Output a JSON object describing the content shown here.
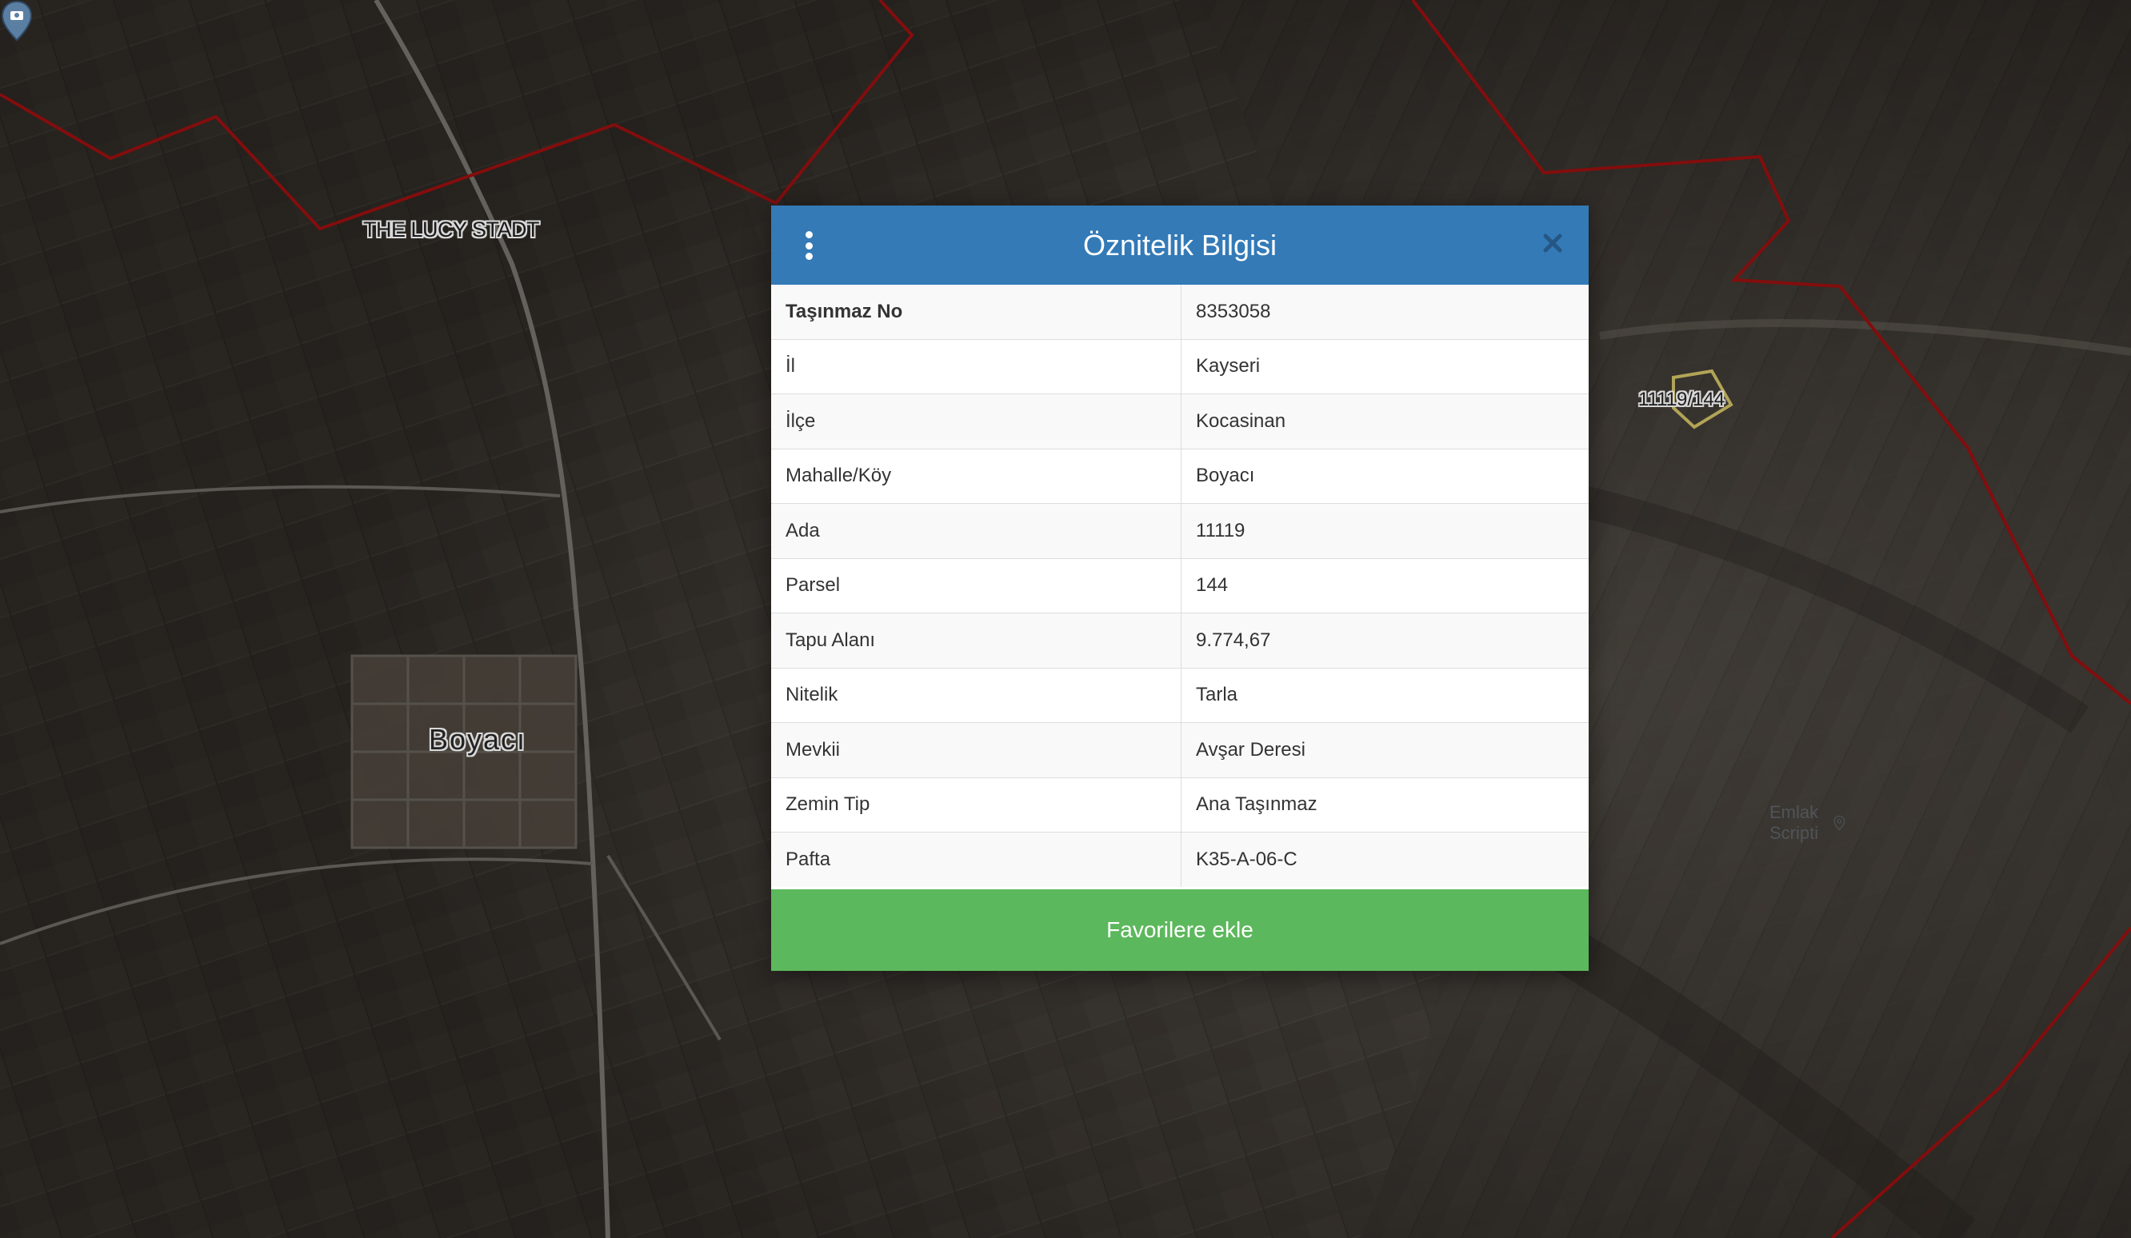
{
  "map": {
    "poi_label": "THE LUCY STADT",
    "village_label": "Boyacı",
    "parcel_label": "11119/144",
    "boundary_color": "#a01010",
    "parcel_outline_color": "#d8c86a"
  },
  "modal": {
    "title": "Öznitelik Bilgisi",
    "header_color": "#337ab7",
    "menu_icon": "kebab-menu-icon",
    "close_icon": "close-icon",
    "rows": [
      {
        "key": "Taşınmaz No",
        "value": "8353058"
      },
      {
        "key": "İl",
        "value": "Kayseri"
      },
      {
        "key": "İlçe",
        "value": "Kocasinan"
      },
      {
        "key": "Mahalle/Köy",
        "value": "Boyacı"
      },
      {
        "key": "Ada",
        "value": "11119"
      },
      {
        "key": "Parsel",
        "value": "144"
      },
      {
        "key": "Tapu Alanı",
        "value": "9.774,67"
      },
      {
        "key": "Nitelik",
        "value": "Tarla"
      },
      {
        "key": "Mevkii",
        "value": "Avşar Deresi"
      },
      {
        "key": "Zemin Tip",
        "value": "Ana Taşınmaz"
      },
      {
        "key": "Pafta",
        "value": "K35-A-06-C"
      }
    ],
    "favorite_button": "Favorilere ekle",
    "favorite_color": "#5cb85c",
    "watermark": "Emlak Scripti"
  }
}
